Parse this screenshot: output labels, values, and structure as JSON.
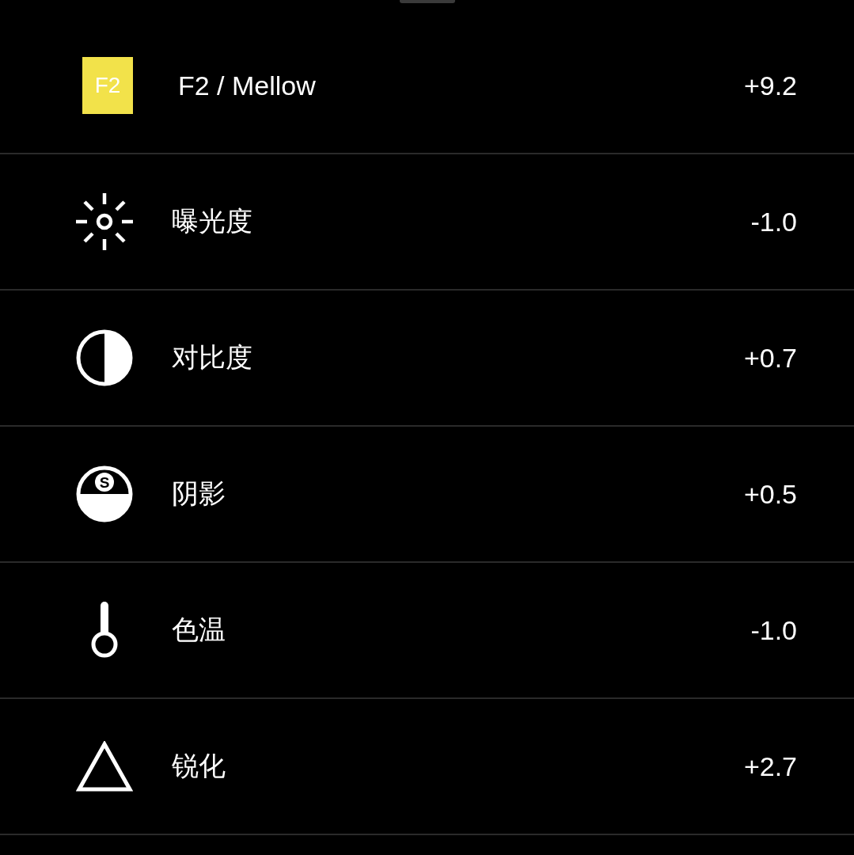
{
  "rows": [
    {
      "kind": "filter",
      "badge": "F2",
      "label": "F2 / Mellow",
      "value": "+9.2"
    },
    {
      "kind": "exposure",
      "label": "曝光度",
      "value": "-1.0"
    },
    {
      "kind": "contrast",
      "label": "对比度",
      "value": "+0.7"
    },
    {
      "kind": "shadows",
      "badge": "S",
      "label": "阴影",
      "value": "+0.5"
    },
    {
      "kind": "temperature",
      "label": "色温",
      "value": "-1.0"
    },
    {
      "kind": "sharpen",
      "label": "锐化",
      "value": "+2.7"
    }
  ]
}
